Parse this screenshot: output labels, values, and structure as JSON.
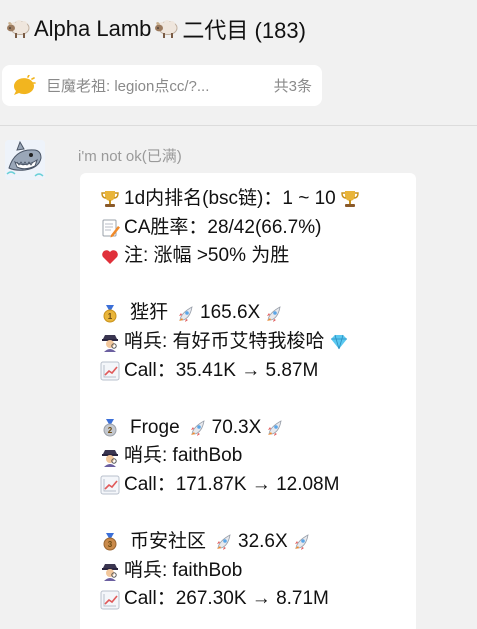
{
  "header": {
    "title_name": "Alpha Lamb",
    "title_suffix": "二代目 (183)"
  },
  "pinned": {
    "text": "巨魔老祖: legion点cc/?...",
    "count": "共3条"
  },
  "message": {
    "sender": "i'm not ok(已满)",
    "rank_line": "1d内排名(bsc链)：1 ~ 10",
    "ca_line": "CA胜率：28/42(66.7%)",
    "note_line": "注: 涨幅 >50% 为胜",
    "entries": [
      {
        "medal": "1",
        "name": "狴犴",
        "multiplier": "165.6X",
        "scout": "哨兵: 有好币艾特我梭哈",
        "call": "Call：35.41K → 5.87M"
      },
      {
        "medal": "2",
        "name": "Froge",
        "multiplier": "70.3X",
        "scout": "哨兵: faithBob",
        "call": "Call：171.87K → 12.08M"
      },
      {
        "medal": "3",
        "name": "币安社区",
        "multiplier": "32.6X",
        "scout": "哨兵: faithBob",
        "call": "Call：267.30K → 8.71M"
      }
    ]
  },
  "colors": {
    "background": "#f1f1f1",
    "bubble": "#ffffff",
    "muted_text": "#8a8a8a",
    "gold_medal": "#e9b53a",
    "silver_medal": "#c4c8cf",
    "bronze_medal": "#c98a4a",
    "rocket": "#e05a5a",
    "heart": "#e0303a"
  },
  "icons": {
    "title": "sheep-icon",
    "pinned": "speech-bubble-icon",
    "rank": "trophy-icon",
    "ca": "memo-icon",
    "note": "heart-icon",
    "entry_name": "medal-icon",
    "multiplier": "rocket-icon",
    "scout": "detective-icon",
    "scout_extra": "gem-icon",
    "call": "chart-increasing-icon"
  }
}
